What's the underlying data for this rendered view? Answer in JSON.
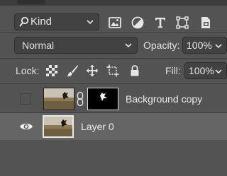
{
  "filter": {
    "kind_label": "Kind"
  },
  "blend": {
    "mode": "Normal",
    "opacity_label": "Opacity:",
    "opacity_value": "100%"
  },
  "lock": {
    "label": "Lock:",
    "fill_label": "Fill:",
    "fill_value": "100%"
  },
  "layers": [
    {
      "name": "Background copy",
      "visible": false,
      "has_mask": true,
      "selected": false
    },
    {
      "name": "Layer 0",
      "visible": true,
      "has_mask": false,
      "selected": true
    }
  ],
  "icons": {
    "filter": [
      "image-filter-icon",
      "adjustment-filter-icon",
      "type-filter-icon",
      "shape-filter-icon",
      "smart-object-filter-icon"
    ],
    "lock": [
      "lock-transparent-pixels-icon",
      "lock-image-pixels-icon",
      "lock-position-icon",
      "lock-artboard-icon",
      "lock-all-icon"
    ]
  }
}
